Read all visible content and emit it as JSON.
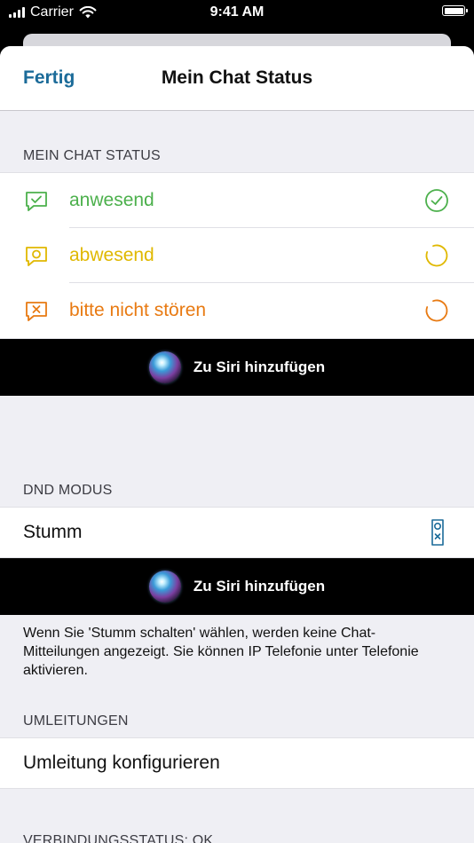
{
  "statusbar": {
    "carrier": "Carrier",
    "time": "9:41 AM"
  },
  "nav": {
    "done_label": "Fertig",
    "title": "Mein Chat Status"
  },
  "chat_status": {
    "header": "MEIN CHAT STATUS",
    "items": [
      {
        "label": "anwesend",
        "color": "#4cb04c",
        "selected": true
      },
      {
        "label": "abwesend",
        "color": "#e0b800",
        "selected": false
      },
      {
        "label": "bitte nicht stören",
        "color": "#e87a12",
        "selected": false
      }
    ]
  },
  "siri": {
    "label": "Zu Siri hinzufügen"
  },
  "dnd": {
    "header": "DND MODUS",
    "row_label": "Stumm",
    "footer": "Wenn Sie 'Stumm schalten' wählen, werden keine Chat-Mitteilungen angezeigt. Sie können IP Telefonie unter Telefonie aktivieren."
  },
  "forwarding": {
    "header": "UMLEITUNGEN",
    "row_label": "Umleitung konfigurieren"
  },
  "connection": {
    "header": "VERBINDUNGSSTATUS: OK"
  },
  "colors": {
    "accent": "#1b6b99",
    "icon_teal": "#1b6b99"
  }
}
